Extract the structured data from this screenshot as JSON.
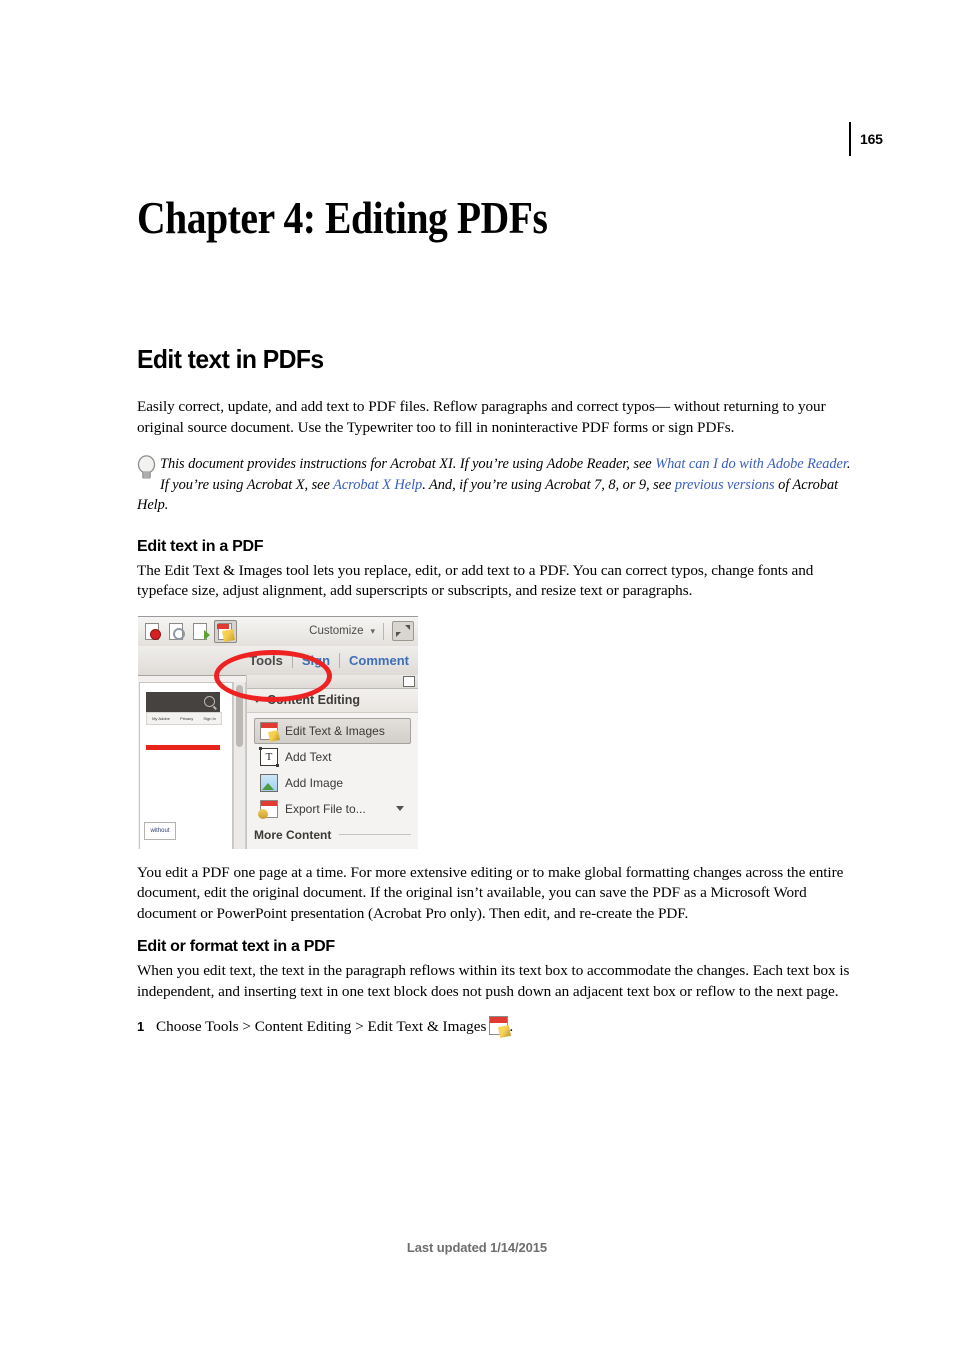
{
  "page": {
    "number": "165",
    "footer": "Last updated 1/14/2015"
  },
  "chapter_title": "Chapter 4: Editing PDFs",
  "section": {
    "title": "Edit text in PDFs",
    "intro": "Easily correct, update, and add text to PDF files. Reflow paragraphs and correct typos— without returning to your original source document. Use the Typewriter too to fill in noninteractive PDF forms or sign PDFs."
  },
  "tip": {
    "icon": "lightbulb-icon",
    "text_1": "This document provides instructions for Acrobat XI. If you’re using Adobe Reader, see ",
    "link_1": "What can I do with Adobe Reader",
    "text_2": ". If you’re using Acrobat X, see ",
    "link_2": "Acrobat X Help",
    "text_3": ". And, if you’re using Acrobat 7, 8, or 9, see ",
    "link_3": "previous versions",
    "text_4": " of Acrobat Help.",
    "link_color": "#3a5ec0"
  },
  "subsection_1": {
    "heading": "Edit text in a PDF",
    "paragraph": "The Edit Text & Images tool lets you replace, edit, or add text to a PDF. You can correct typos, change fonts and typeface size, adjust alignment, add superscripts or subscripts, and resize text or paragraphs.",
    "after_figure": "You edit a PDF one page at a time. For more extensive editing or to make global formatting changes across the entire document, edit the original document. If the original isn’t available, you can save the PDF as a Microsoft Word document or PowerPoint presentation (Acrobat Pro only). Then edit, and re-create the PDF."
  },
  "figure": {
    "annotation_color": "#ee2222",
    "toolbar": {
      "icons": [
        {
          "name": "attach-file-icon"
        },
        {
          "name": "find-icon"
        },
        {
          "name": "export-pdf-icon"
        },
        {
          "name": "edit-text-images-icon"
        }
      ],
      "customize_label": "Customize",
      "customize_caret": "▾",
      "expand_icon": "expand-view-icon"
    },
    "tabs": [
      {
        "label": "Tools",
        "active": true
      },
      {
        "label": "Sign",
        "active": false
      },
      {
        "label": "Comment",
        "active": false
      }
    ],
    "doc_pane": {
      "nav_links": [
        "My Adobe",
        "Privacy",
        "Sign In"
      ],
      "search_icon": "search-icon",
      "text_box_value": "without"
    },
    "panel": {
      "header": "Content Editing",
      "items": [
        {
          "label": "Edit Text & Images",
          "icon": "edit-text-images-icon",
          "selected": true,
          "has_caret": false
        },
        {
          "label": "Add Text",
          "icon": "add-text-icon",
          "selected": false,
          "has_caret": false
        },
        {
          "label": "Add Image",
          "icon": "add-image-icon",
          "selected": false,
          "has_caret": false
        },
        {
          "label": "Export File to...",
          "icon": "export-file-icon",
          "selected": false,
          "has_caret": true
        }
      ],
      "more_label": "More Content"
    }
  },
  "subsection_2": {
    "heading": "Edit or format text in a PDF",
    "paragraph": "When you edit text, the text in the paragraph reflows within its text box to accommodate the changes. Each text box is independent, and inserting text in one text block does not push down an adjacent text box or reflow to the next page.",
    "step_1": {
      "number": "1",
      "text_before": "Choose Tools > Content Editing > Edit Text & Images",
      "icon": "edit-text-images-icon",
      "text_after": "."
    }
  }
}
